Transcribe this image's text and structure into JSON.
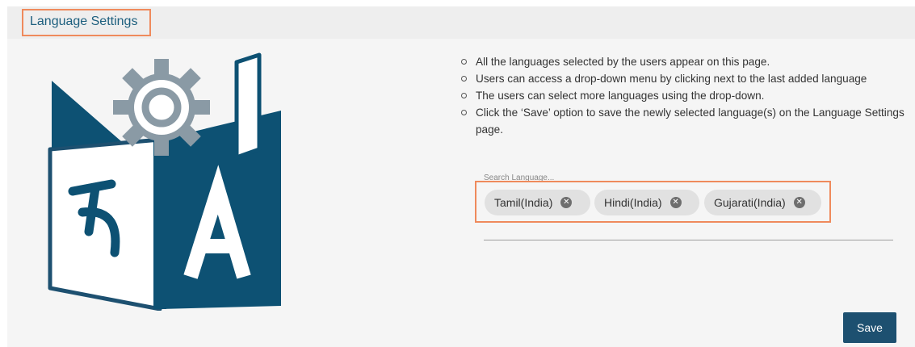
{
  "header": {
    "title": "Language Settings"
  },
  "info": {
    "bullets": [
      "All the languages selected by the users appear on this page.",
      "Users can access a drop-down menu by clicking next to the last added language",
      "The users can select more languages using the drop-down.",
      "Click the ‘Save’ option to save the newly selected language(s) on the Language Settings page."
    ]
  },
  "search": {
    "label": "Search Language...",
    "chips": [
      "Tamil(India)",
      "Hindi(India)",
      "Gujarati(India)"
    ]
  },
  "actions": {
    "save_label": "Save"
  },
  "colors": {
    "accent": "#1d5070",
    "highlight_border": "#ef8a5c",
    "title_text": "#1d5f7e"
  },
  "icons": [
    "language-settings-icon",
    "gear-icon",
    "close-circle-icon"
  ]
}
